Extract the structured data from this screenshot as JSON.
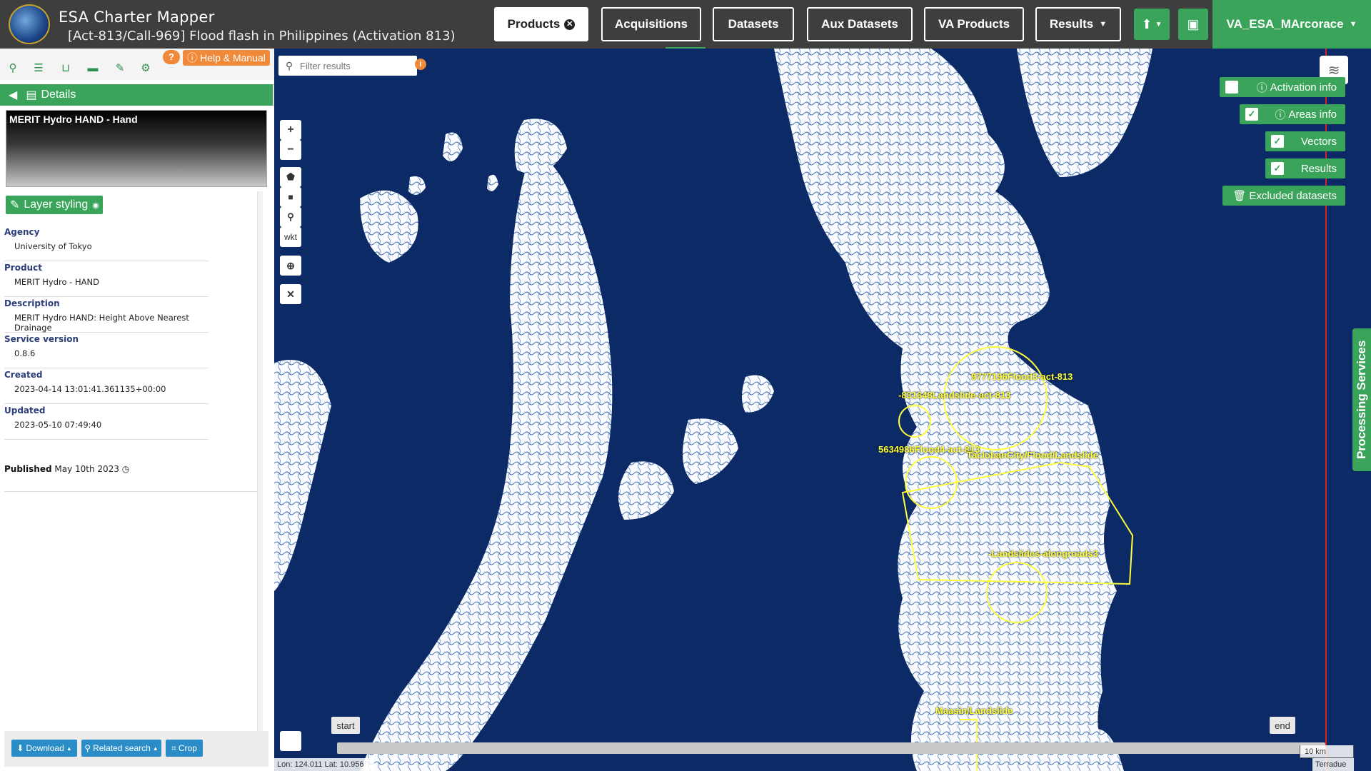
{
  "header": {
    "app_title": "ESA Charter Mapper",
    "activation_title": "[Act-813/Call-969] Flood flash in Philippines (Activation 813)",
    "nav": {
      "products": "Products",
      "acquisitions": "Acquisitions",
      "datasets": "Datasets",
      "aux_datasets": "Aux Datasets",
      "va_products": "VA Products",
      "results": "Results"
    },
    "user": "VA_ESA_MArcorace"
  },
  "left_panel": {
    "help_label": "Help & Manual",
    "details_label": "Details",
    "preview_title": "MERIT Hydro HAND - Hand",
    "layer_styling_label": "Layer styling",
    "fields": [
      {
        "label": "Agency",
        "value": "University of Tokyo"
      },
      {
        "label": "Product",
        "value": "MERIT Hydro - HAND"
      },
      {
        "label": "Description",
        "value": "MERIT Hydro HAND: Height Above Nearest Drainage"
      },
      {
        "label": "Service version",
        "value": "0.8.6"
      },
      {
        "label": "Created",
        "value": "2023-04-14 13:01:41.361135+00:00"
      },
      {
        "label": "Updated",
        "value": "2023-05-10 07:49:40"
      }
    ],
    "published_label": "Published",
    "published_date": "May 10th 2023",
    "buttons": {
      "download": "Download",
      "related_search": "Related search",
      "crop": "Crop"
    }
  },
  "map": {
    "filter_placeholder": "Filter results",
    "wkt_label": "wkt",
    "overlay_buttons": {
      "activation_info": "Activation info",
      "areas_info": "Areas info",
      "vectors": "Vectors",
      "results": "Results",
      "excluded_datasets": "Excluded datasets"
    },
    "processing_services": "Processing Services",
    "timeline": {
      "start": "start",
      "end": "end"
    },
    "aoi_labels": [
      "-831648Landslide-act-813",
      "9777196Flood3-act-813",
      "5634986Flood4-act-813",
      "TaclobanCity/Flood/Landslide",
      "-Landslides-alongroads3",
      "Maasin/Landslide"
    ],
    "coords": "Lon: 124.011 Lat: 10.956",
    "scale": "10 km",
    "attribution": "Terradue"
  },
  "colors": {
    "accent_green": "#3aa55a",
    "header_gray": "#3e3e3e",
    "water_blue": "#0b2a66",
    "aoi_yellow": "#ffff3a",
    "help_orange": "#f08a3a"
  }
}
